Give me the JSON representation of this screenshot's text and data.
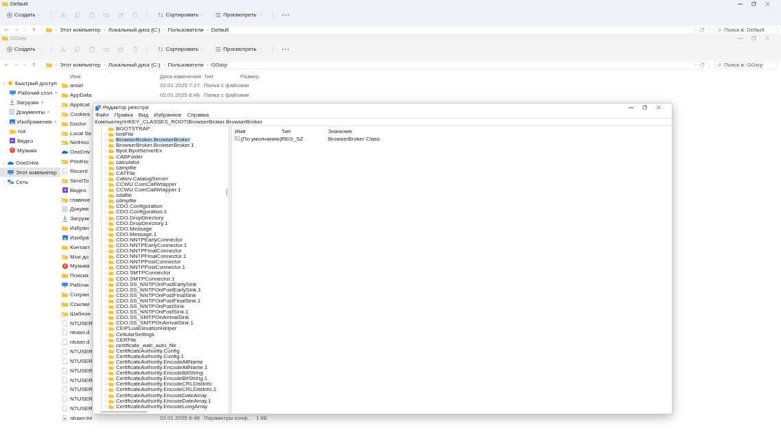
{
  "explorer_back": {
    "title": "Default",
    "toolbar": {
      "create": "Создать",
      "sort": "Сортировать",
      "view": "Просмотреть"
    },
    "breadcrumb": [
      "Этот компьютер",
      "Локальный диск (C:)",
      "Пользователи",
      "Default"
    ],
    "search": {
      "placeholder": "Поиск в: Default"
    }
  },
  "explorer_front": {
    "title": "GGsrp",
    "toolbar": {
      "create": "Создать",
      "sort": "Сортировать",
      "view": "Просмотреть"
    },
    "breadcrumb": [
      "Этот компьютер",
      "Локальный диск (C:)",
      "Пользователи",
      "GGsrp"
    ],
    "search": {
      "placeholder": "Поиск в: GGsrp"
    },
    "nav": [
      {
        "label": "Быстрый доступ",
        "kind": "star",
        "expanded": true,
        "selected": false,
        "children": [
          {
            "label": "Рабочий стол",
            "kind": "desktop",
            "pinned": true,
            "selected": false
          },
          {
            "label": "Загрузки",
            "kind": "downloads",
            "pinned": true,
            "selected": false
          },
          {
            "label": "Документы",
            "kind": "documents",
            "pinned": true,
            "selected": false
          },
          {
            "label": "Изображения",
            "kind": "pictures",
            "pinned": true,
            "selected": false
          },
          {
            "label": "not",
            "kind": "folder",
            "pinned": false,
            "selected": false
          },
          {
            "label": "Видео",
            "kind": "video",
            "pinned": false,
            "selected": false
          },
          {
            "label": "Музыка",
            "kind": "music",
            "pinned": false,
            "selected": false
          }
        ]
      },
      {
        "label": "OneDrive",
        "kind": "onedrive",
        "expanded": false,
        "selected": false
      },
      {
        "label": "Этот компьютер",
        "kind": "pc",
        "expanded": false,
        "selected": true
      },
      {
        "label": "Сеть",
        "kind": "network",
        "expanded": false,
        "selected": false
      }
    ],
    "columns": [
      "Имя",
      "Дата изменения",
      "Тип",
      "Размер"
    ],
    "files": [
      {
        "name": "ansel",
        "kind": "folder",
        "date": "02.01.2025 7:17",
        "type": "Папка с файлами"
      },
      {
        "name": "AppData",
        "kind": "folder",
        "date": "02.01.2025 6:46",
        "type": "Папка с файлами"
      },
      {
        "name": "Applicat",
        "kind": "link-folder"
      },
      {
        "name": "Cookies",
        "kind": "link-folder"
      },
      {
        "name": "Doctor",
        "kind": "folder"
      },
      {
        "name": "Local Se",
        "kind": "link-folder"
      },
      {
        "name": "NetHoo",
        "kind": "link-folder"
      },
      {
        "name": "OneDriv",
        "kind": "onedrive"
      },
      {
        "name": "PrintHo",
        "kind": "link-folder"
      },
      {
        "name": "Recent",
        "kind": "link-file"
      },
      {
        "name": "SendTo",
        "kind": "link-folder"
      },
      {
        "name": "Видео",
        "kind": "video"
      },
      {
        "name": "главное",
        "kind": "link-folder"
      },
      {
        "name": "Докуме",
        "kind": "documents"
      },
      {
        "name": "Загрузк",
        "kind": "downloads"
      },
      {
        "name": "Избран",
        "kind": "folder"
      },
      {
        "name": "Изобра",
        "kind": "pictures"
      },
      {
        "name": "Контакт",
        "kind": "folder"
      },
      {
        "name": "Мои до",
        "kind": "link-folder"
      },
      {
        "name": "Музыка",
        "kind": "music"
      },
      {
        "name": "Поиски",
        "kind": "folder"
      },
      {
        "name": "Рабочи",
        "kind": "desktop"
      },
      {
        "name": "Сохран",
        "kind": "folder"
      },
      {
        "name": "Ссылки",
        "kind": "folder"
      },
      {
        "name": "Шаблон",
        "kind": "link-folder"
      },
      {
        "name": "NTUSER",
        "kind": "file"
      },
      {
        "name": "ntuser.d",
        "kind": "file"
      },
      {
        "name": "ntuser.d",
        "kind": "file"
      },
      {
        "name": "NTUSER",
        "kind": "file"
      },
      {
        "name": "NTUSER",
        "kind": "file"
      },
      {
        "name": "NTUSER",
        "kind": "file"
      },
      {
        "name": "NTUSER",
        "kind": "file"
      },
      {
        "name": "NTUSER",
        "kind": "file"
      },
      {
        "name": "NTUSER",
        "kind": "file"
      },
      {
        "name": "NTUSER",
        "kind": "file"
      },
      {
        "name": "ntuser.ini",
        "kind": "ini",
        "date": "02.01.2025 6:46",
        "type": "Параметры конф...",
        "size": "1 КБ"
      }
    ]
  },
  "registry_editor": {
    "title": "Редактор реестра",
    "menu": [
      "Файл",
      "Правка",
      "Вид",
      "Избранное",
      "Справка"
    ],
    "address": "Компьютер\\HKEY_CLASSES_ROOT\\BrowserBroker.BrowserBroker",
    "tree": [
      {
        "label": "BOOTSTRAP",
        "expandable": false,
        "selected": false
      },
      {
        "label": "bmlFile",
        "expandable": true,
        "selected": false
      },
      {
        "label": "BrowserBroker.BrowserBroker",
        "expandable": true,
        "selected": true
      },
      {
        "label": "BrowserBroker.BrowserBroker.1",
        "expandable": true,
        "selected": false
      },
      {
        "label": "Byot.ByotServerEx",
        "expandable": true,
        "selected": false
      },
      {
        "label": "CABFolder",
        "expandable": true,
        "selected": false
      },
      {
        "label": "calculator",
        "expandable": false,
        "selected": false
      },
      {
        "label": "campfile",
        "expandable": true,
        "selected": false
      },
      {
        "label": "CATFile",
        "expandable": true,
        "selected": false
      },
      {
        "label": "Catsrv.CatalogServer",
        "expandable": true,
        "selected": false
      },
      {
        "label": "CCWU.ComCallWrapper",
        "expandable": true,
        "selected": false
      },
      {
        "label": "CCWU.ComCallWrapper.1",
        "expandable": true,
        "selected": false
      },
      {
        "label": "cdafile",
        "expandable": false,
        "selected": false
      },
      {
        "label": "cdmpfile",
        "expandable": true,
        "selected": false
      },
      {
        "label": "CDO.Configuration",
        "expandable": true,
        "selected": false
      },
      {
        "label": "CDO.Configuration.1",
        "expandable": true,
        "selected": false
      },
      {
        "label": "CDO.DropDirectory",
        "expandable": true,
        "selected": false
      },
      {
        "label": "CDO.DropDirectory.1",
        "expandable": true,
        "selected": false
      },
      {
        "label": "CDO.Message",
        "expandable": true,
        "selected": false
      },
      {
        "label": "CDO.Message.1",
        "expandable": true,
        "selected": false
      },
      {
        "label": "CDO.NNTPEarlyConnector",
        "expandable": true,
        "selected": false
      },
      {
        "label": "CDO.NNTPEarlyConnector.1",
        "expandable": true,
        "selected": false
      },
      {
        "label": "CDO.NNTPFinalConnector",
        "expandable": true,
        "selected": false
      },
      {
        "label": "CDO.NNTPFinalConnector.1",
        "expandable": true,
        "selected": false
      },
      {
        "label": "CDO.NNTPPostConnector",
        "expandable": true,
        "selected": false
      },
      {
        "label": "CDO.NNTPPostConnector.1",
        "expandable": true,
        "selected": false
      },
      {
        "label": "CDO.SMTPConnector",
        "expandable": true,
        "selected": false
      },
      {
        "label": "CDO.SMTPConnector.1",
        "expandable": true,
        "selected": false
      },
      {
        "label": "CDO.SS_NNTPOnPostEarlySink",
        "expandable": true,
        "selected": false
      },
      {
        "label": "CDO.SS_NNTPOnPostEarlySink.1",
        "expandable": true,
        "selected": false
      },
      {
        "label": "CDO.SS_NNTPOnPostFinalSink",
        "expandable": true,
        "selected": false
      },
      {
        "label": "CDO.SS_NNTPOnPostFinalSink.1",
        "expandable": true,
        "selected": false
      },
      {
        "label": "CDO.SS_NNTPOnPostSink",
        "expandable": true,
        "selected": false
      },
      {
        "label": "CDO.SS_NNTPOnPostSink.1",
        "expandable": true,
        "selected": false
      },
      {
        "label": "CDO.SS_SMTPOnArrivalSink",
        "expandable": true,
        "selected": false
      },
      {
        "label": "CDO.SS_SMTPOnArrivalSink.1",
        "expandable": true,
        "selected": false
      },
      {
        "label": "CEIPLuaElevationHelper",
        "expandable": true,
        "selected": false
      },
      {
        "label": "CellularSettings",
        "expandable": true,
        "selected": false
      },
      {
        "label": "CERFile",
        "expandable": true,
        "selected": false
      },
      {
        "label": "certificate_wab_auto_file",
        "expandable": true,
        "selected": false
      },
      {
        "label": "CertificateAuthority.Config",
        "expandable": true,
        "selected": false
      },
      {
        "label": "CertificateAuthority.Config.1",
        "expandable": true,
        "selected": false
      },
      {
        "label": "CertificateAuthority.EncodeAltName",
        "expandable": true,
        "selected": false
      },
      {
        "label": "CertificateAuthority.EncodeAltName.1",
        "expandable": true,
        "selected": false
      },
      {
        "label": "CertificateAuthority.EncodeBitString",
        "expandable": true,
        "selected": false
      },
      {
        "label": "CertificateAuthority.EncodeBitString.1",
        "expandable": true,
        "selected": false
      },
      {
        "label": "CertificateAuthority.EncodeCRLDistInfo",
        "expandable": true,
        "selected": false
      },
      {
        "label": "CertificateAuthority.EncodeCRLDistInfo.1",
        "expandable": true,
        "selected": false
      },
      {
        "label": "CertificateAuthority.EncodeDateArray",
        "expandable": true,
        "selected": false
      },
      {
        "label": "CertificateAuthority.EncodeDateArray.1",
        "expandable": true,
        "selected": false
      },
      {
        "label": "CertificateAuthority.EncodeLongArray",
        "expandable": true,
        "selected": false
      }
    ],
    "columns": [
      "Имя",
      "Тип",
      "Значение"
    ],
    "values": [
      {
        "name": "(По умолчанию)",
        "type": "REG_SZ",
        "data": "BrowserBroker Class"
      }
    ]
  }
}
